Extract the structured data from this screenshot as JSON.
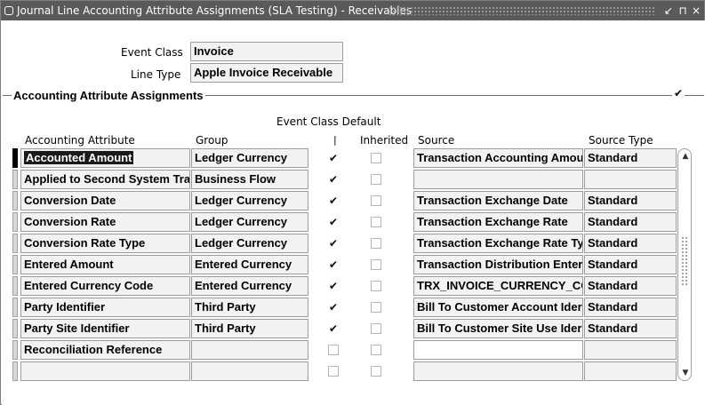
{
  "window": {
    "title": "Journal Line Accounting Attribute Assignments (SLA Testing) - Receivables",
    "controls": [
      "↙",
      "⊓",
      "×"
    ]
  },
  "header": {
    "event_class_label": "Event Class",
    "event_class_value": "Invoice",
    "line_type_label": "Line Type",
    "line_type_value": "Apple Invoice Receivable"
  },
  "section": {
    "title": "Accounting Attribute Assignments",
    "check_glyph": "✔"
  },
  "columns": {
    "event_class_default": "Event Class Default",
    "accounting_attribute": "Accounting Attribute",
    "group": "Group",
    "separator": "|",
    "inherited": "Inherited",
    "source": "Source",
    "source_type": "Source Type"
  },
  "check_glyph": "✔",
  "rows": [
    {
      "attribute": "Accounted Amount",
      "group": "Ledger Currency",
      "default": true,
      "inherited": false,
      "source": "Transaction Accounting Amou",
      "source_type": "Standard",
      "current": true
    },
    {
      "attribute": "Applied to Second System Tra",
      "group": "Business Flow",
      "default": true,
      "inherited": false,
      "source": "",
      "source_type": "",
      "current": false
    },
    {
      "attribute": "Conversion Date",
      "group": "Ledger Currency",
      "default": true,
      "inherited": false,
      "source": "Transaction Exchange Date",
      "source_type": "Standard",
      "current": false
    },
    {
      "attribute": "Conversion Rate",
      "group": "Ledger Currency",
      "default": true,
      "inherited": false,
      "source": "Transaction Exchange Rate",
      "source_type": "Standard",
      "current": false
    },
    {
      "attribute": "Conversion Rate Type",
      "group": "Ledger Currency",
      "default": true,
      "inherited": false,
      "source": "Transaction Exchange Rate Ty",
      "source_type": "Standard",
      "current": false
    },
    {
      "attribute": "Entered Amount",
      "group": "Entered Currency",
      "default": true,
      "inherited": false,
      "source": "Transaction Distribution Enter",
      "source_type": "Standard",
      "current": false
    },
    {
      "attribute": "Entered Currency Code",
      "group": "Entered Currency",
      "default": true,
      "inherited": false,
      "source": "TRX_INVOICE_CURRENCY_CO",
      "source_type": "Standard",
      "current": false
    },
    {
      "attribute": "Party Identifier",
      "group": "Third Party",
      "default": true,
      "inherited": false,
      "source": "Bill To Customer Account Ider",
      "source_type": "Standard",
      "current": false
    },
    {
      "attribute": "Party Site Identifier",
      "group": "Third Party",
      "default": true,
      "inherited": false,
      "source": "Bill To Customer Site Use Ider",
      "source_type": "Standard",
      "current": false
    },
    {
      "attribute": "Reconciliation Reference",
      "group": "",
      "default": false,
      "inherited": false,
      "source": "",
      "source_type": "",
      "current": false,
      "source_editable": true
    },
    {
      "attribute": "",
      "group": "",
      "default": false,
      "inherited": false,
      "source": "",
      "source_type": "",
      "current": false
    }
  ],
  "scrollbar": {
    "up": "▲",
    "down": "▼"
  }
}
